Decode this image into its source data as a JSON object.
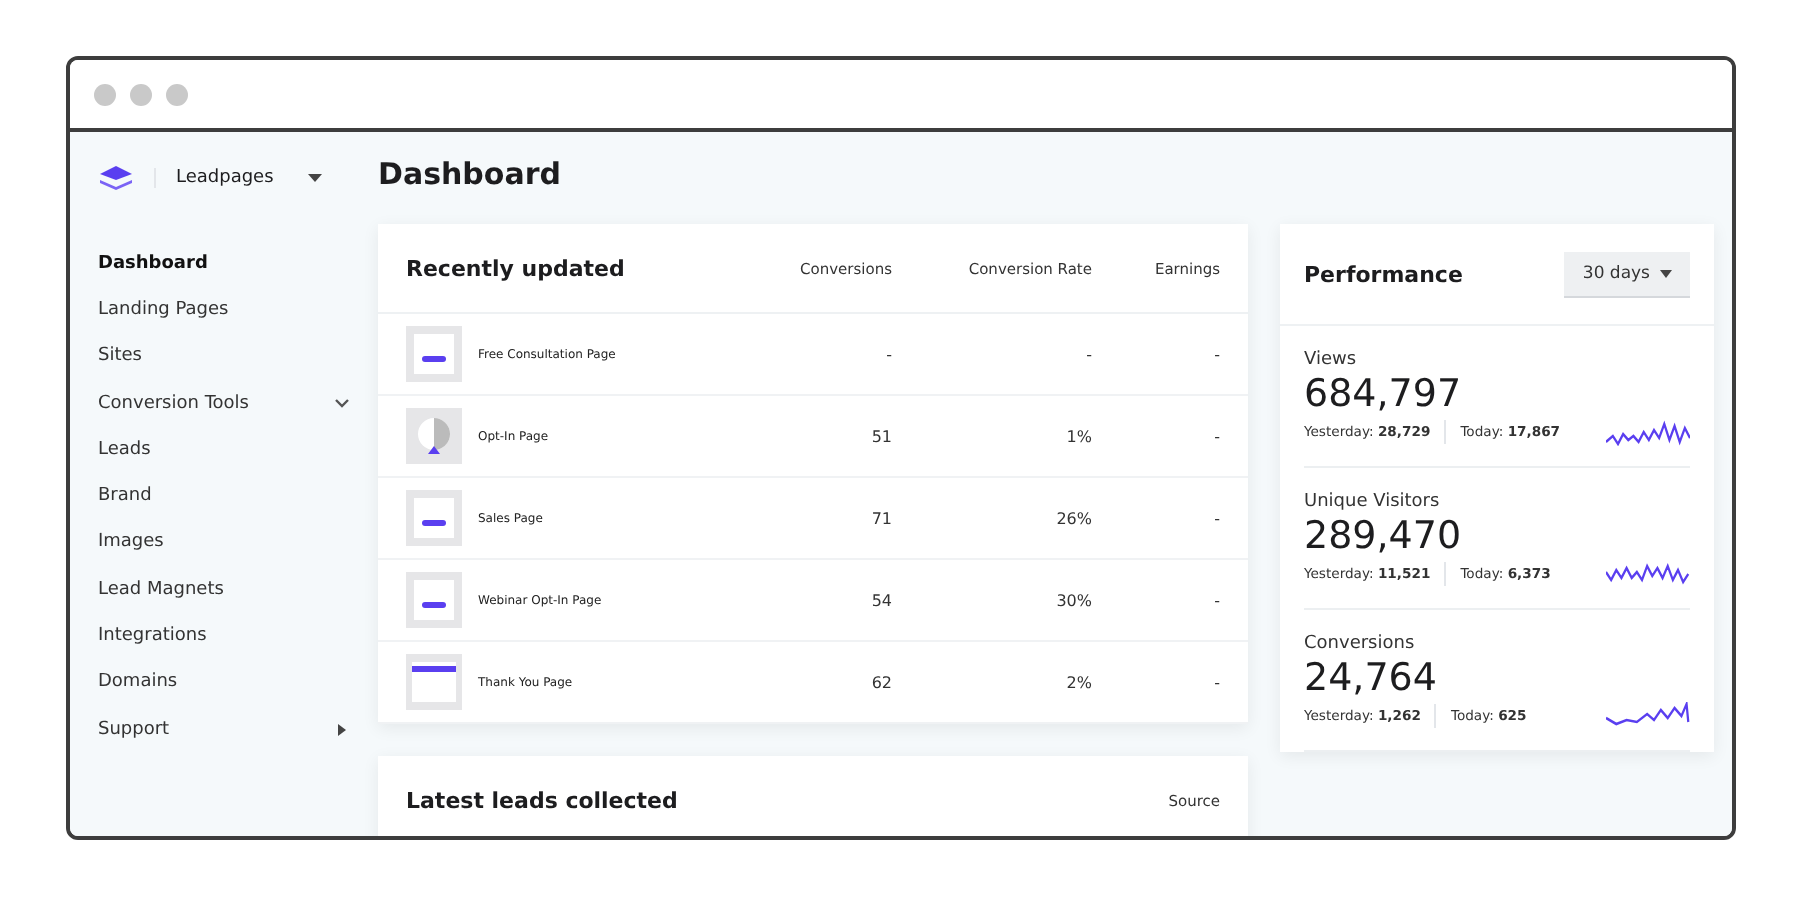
{
  "brand": {
    "name": "Leadpages"
  },
  "page_title": "Dashboard",
  "sidebar": {
    "items": [
      {
        "label": "Dashboard",
        "selected": true,
        "kind": "plain"
      },
      {
        "label": "Landing Pages",
        "selected": false,
        "kind": "plain"
      },
      {
        "label": "Sites",
        "selected": false,
        "kind": "plain"
      },
      {
        "label": "Conversion Tools",
        "selected": false,
        "kind": "expandable"
      },
      {
        "label": "Leads",
        "selected": false,
        "kind": "plain"
      },
      {
        "label": "Brand",
        "selected": false,
        "kind": "plain"
      },
      {
        "label": "Images",
        "selected": false,
        "kind": "plain"
      },
      {
        "label": "Lead Magnets",
        "selected": false,
        "kind": "plain"
      },
      {
        "label": "Integrations",
        "selected": false,
        "kind": "plain"
      },
      {
        "label": "Domains",
        "selected": false,
        "kind": "plain"
      },
      {
        "label": "Support",
        "selected": false,
        "kind": "submenu"
      }
    ]
  },
  "recently_updated": {
    "title": "Recently updated",
    "columns": [
      "Conversions",
      "Conversion Rate",
      "Earnings"
    ],
    "rows": [
      {
        "name": "Free Consultation Page",
        "kind": "bar",
        "conversions": "-",
        "rate": "-",
        "earnings": "-"
      },
      {
        "name": "Opt-In Page",
        "kind": "half",
        "conversions": "51",
        "rate": "1%",
        "earnings": "-"
      },
      {
        "name": "Sales Page",
        "kind": "bar",
        "conversions": "71",
        "rate": "26%",
        "earnings": "-"
      },
      {
        "name": "Webinar Opt-In Page",
        "kind": "bar",
        "conversions": "54",
        "rate": "30%",
        "earnings": "-"
      },
      {
        "name": "Thank You Page",
        "kind": "header",
        "conversions": "62",
        "rate": "2%",
        "earnings": "-"
      }
    ]
  },
  "latest_leads": {
    "title": "Latest leads collected",
    "columns": [
      "Source"
    ]
  },
  "performance": {
    "title": "Performance",
    "range": "30 days",
    "metrics": [
      {
        "label": "Views",
        "value": "684,797",
        "yesterday": "Yesterday: **28,729**",
        "today": "Today: **17,867**"
      },
      {
        "label": "Unique Visitors",
        "value": "289,470",
        "yesterday": "Yesterday: **11,521**",
        "today": "Today: **6,373**"
      },
      {
        "label": "Conversions",
        "value": "24,764",
        "yesterday": "Yesterday: **1,262**",
        "today": "Today: **625**"
      }
    ]
  }
}
